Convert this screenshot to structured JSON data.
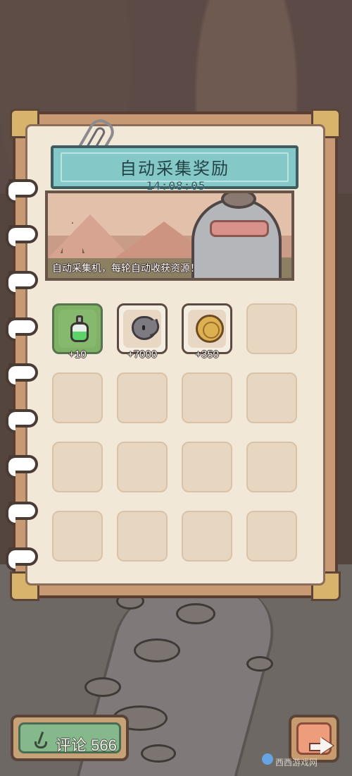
{
  "panel": {
    "title": "自动采集奖励",
    "timer": "14:08:05",
    "description": "自动采集机，每轮自动收获资源！"
  },
  "rewards": [
    {
      "count": "+10",
      "icon": "potion-icon"
    },
    {
      "count": "+7000",
      "icon": "slime-icon"
    },
    {
      "count": "+350",
      "icon": "coin-icon"
    }
  ],
  "footer": {
    "comment_label": "评论",
    "comment_count": "566"
  },
  "watermark": {
    "text": "西西游戏网"
  }
}
